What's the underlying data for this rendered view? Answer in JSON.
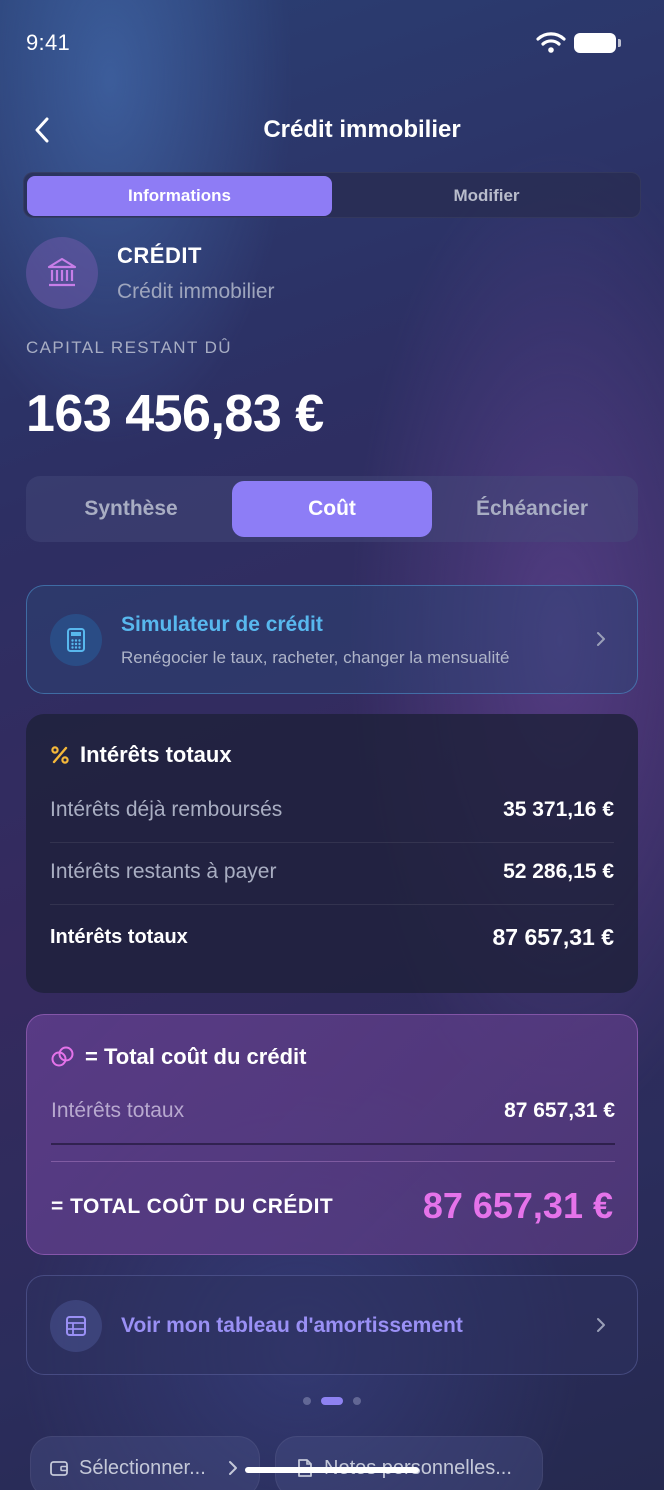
{
  "status_bar": {
    "time": "9:41"
  },
  "nav": {
    "title": "Crédit immobilier"
  },
  "top_segment": {
    "active": "Informations",
    "inactive": "Modifier"
  },
  "credit": {
    "type": "CRÉDIT",
    "name": "Crédit immobilier",
    "capital_label": "CAPITAL RESTANT DÛ",
    "capital_value": "163 456,83 €"
  },
  "tabs": [
    {
      "label": "Synthèse",
      "active": false
    },
    {
      "label": "Coût",
      "active": true
    },
    {
      "label": "Échéancier",
      "active": false
    }
  ],
  "simulator": {
    "title": "Simulateur de crédit",
    "subtitle": "Renégocier le taux, racheter, changer la mensualité"
  },
  "interests": {
    "title": "Intérêts totaux",
    "rows": [
      {
        "label": "Intérêts déjà remboursés",
        "value": "35 371,16 €"
      },
      {
        "label": "Intérêts restants à payer",
        "value": "52 286,15 €"
      }
    ],
    "total": {
      "label": "Intérêts totaux",
      "value": "87 657,31 €"
    }
  },
  "total_cost": {
    "title": "= Total coût du crédit",
    "row": {
      "label": "Intérêts totaux",
      "value": "87 657,31 €"
    },
    "total_label": "= TOTAL COÛT DU CRÉDIT",
    "total_value": "87 657,31 €"
  },
  "amortization": {
    "label": "Voir mon tableau d'amortissement"
  },
  "pager": {
    "count": 3,
    "active": 2
  },
  "bottom_chips": [
    {
      "label": "Sélectionner..."
    },
    {
      "label": "Notes personnelles..."
    }
  ],
  "colors": {
    "accent": "#8e7cf5",
    "simulator": "#58b8ee",
    "total_cost": "#e573ea",
    "percent_icon": "#f5b83a"
  }
}
